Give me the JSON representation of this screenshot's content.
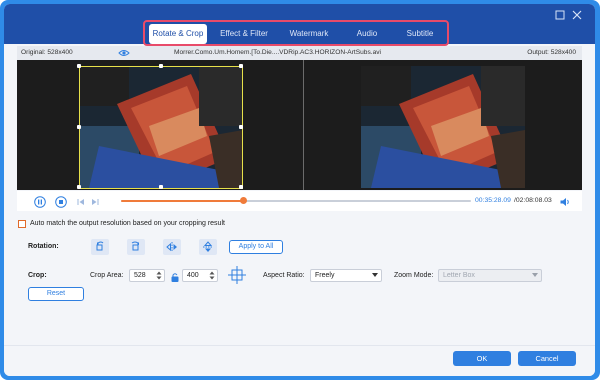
{
  "tabs": [
    {
      "label": "Rotate & Crop",
      "active": true
    },
    {
      "label": "Effect & Filter",
      "active": false
    },
    {
      "label": "Watermark",
      "active": false
    },
    {
      "label": "Audio",
      "active": false
    },
    {
      "label": "Subtitle",
      "active": false
    }
  ],
  "info_bar": {
    "original": "Original: 528x400",
    "filename": "Morrer.Como.Um.Homem.[To.Die....VDRip.AC3.HORIZON-ArtSubs.avi",
    "output": "Output: 528x400"
  },
  "playback": {
    "current_time": "00:35:28.09",
    "total_time": "/02:08:08.03",
    "progress": 0.35
  },
  "options": {
    "auto_match_label": "Auto match the output resolution based on your cropping result",
    "auto_match_checked": false,
    "rotation_label": "Rotation:",
    "apply_all_label": "Apply to All",
    "crop_label": "Crop:",
    "crop_area_label": "Crop Area:",
    "crop_width": "528",
    "crop_height": "400",
    "aspect_ratio_label": "Aspect Ratio:",
    "aspect_ratio_value": "Freely",
    "zoom_mode_label": "Zoom Mode:",
    "zoom_mode_value": "Letter Box",
    "reset_label": "Reset"
  },
  "footer": {
    "ok_label": "OK",
    "cancel_label": "Cancel"
  },
  "colors": {
    "accent": "#2f7fe0",
    "titlebar": "#1f4fa8",
    "tab_highlight_border": "#e84b6a",
    "timeline_progress": "#f07b3a",
    "crop_border": "#e7e14a"
  },
  "icons": {
    "preview_toggle": "eye-icon",
    "pause": "pause-icon",
    "stop": "stop-icon",
    "prev": "previous-frame-icon",
    "next": "next-frame-icon",
    "volume": "volume-icon",
    "rotate_left": "rotate-left-icon",
    "rotate_right": "rotate-right-icon",
    "flip_horizontal": "flip-horizontal-icon",
    "flip_vertical": "flip-vertical-icon",
    "lock_ratio": "lock-icon",
    "center_crop": "crosshair-icon"
  }
}
